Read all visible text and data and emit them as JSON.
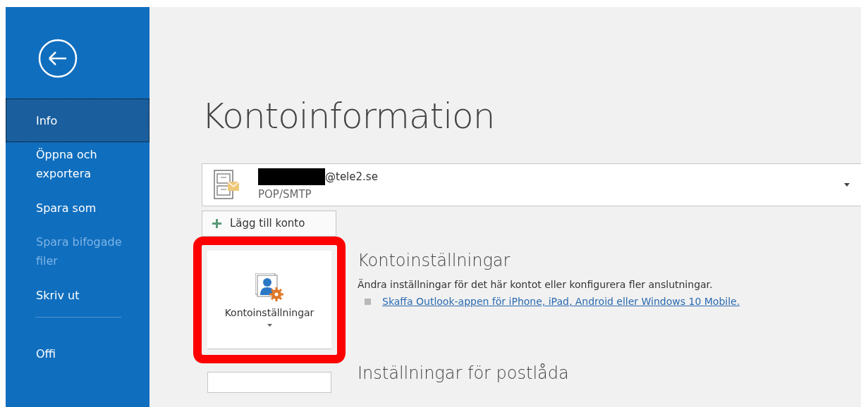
{
  "sidebar": {
    "items": [
      {
        "label": "Info",
        "selected": true,
        "disabled": false
      },
      {
        "label": "Öppna och exportera",
        "selected": false,
        "disabled": false
      },
      {
        "label": "Spara som",
        "selected": false,
        "disabled": false
      },
      {
        "label": "Spara bifogade filer",
        "selected": false,
        "disabled": true
      },
      {
        "label": "Skriv ut",
        "selected": false,
        "disabled": false
      },
      {
        "label": "Offi",
        "selected": false,
        "disabled": false
      }
    ]
  },
  "page_title": "Kontoinformation",
  "account": {
    "email_domain": "@tele2.se",
    "type": "POP/SMTP"
  },
  "add_account_button": "Lägg till konto",
  "sections": [
    {
      "button_label": "Kontoinställningar",
      "highlighted": true,
      "heading": "Kontoinställningar",
      "description": "Ändra inställningar för det här kontot eller konfigurera fler anslutningar.",
      "link": "Skaffa Outlook-appen för iPhone, iPad, Android eller Windows 10 Mobile."
    },
    {
      "highlighted": false,
      "heading": "Inställningar för postlåda"
    }
  ]
}
